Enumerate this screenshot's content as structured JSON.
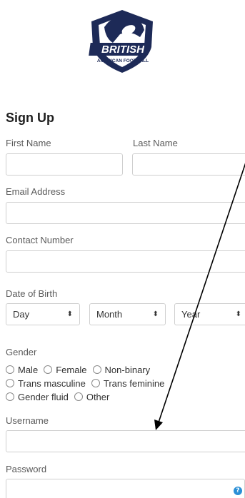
{
  "logo": {
    "line1": "BRITISH",
    "line2": "AMERICAN FOOTBALL"
  },
  "form": {
    "title": "Sign Up",
    "first_name_label": "First Name",
    "last_name_label": "Last Name",
    "email_label": "Email Address",
    "contact_label": "Contact Number",
    "dob_label": "Date of Birth",
    "dob": {
      "day": "Day",
      "month": "Month",
      "year": "Year"
    },
    "gender_label": "Gender",
    "gender_options": [
      "Male",
      "Female",
      "Non-binary",
      "Trans masculine",
      "Trans feminine",
      "Gender fluid",
      "Other"
    ],
    "username_label": "Username",
    "password_label": "Password"
  },
  "icons": {
    "select_caret": "updown-caret-icon",
    "help": "question-circle-icon",
    "help_glyph": "?",
    "caret_glyph": "⬍"
  },
  "colors": {
    "brand_navy": "#1d2a57",
    "help_blue": "#2a8fd6",
    "border": "#cfcfcf"
  }
}
